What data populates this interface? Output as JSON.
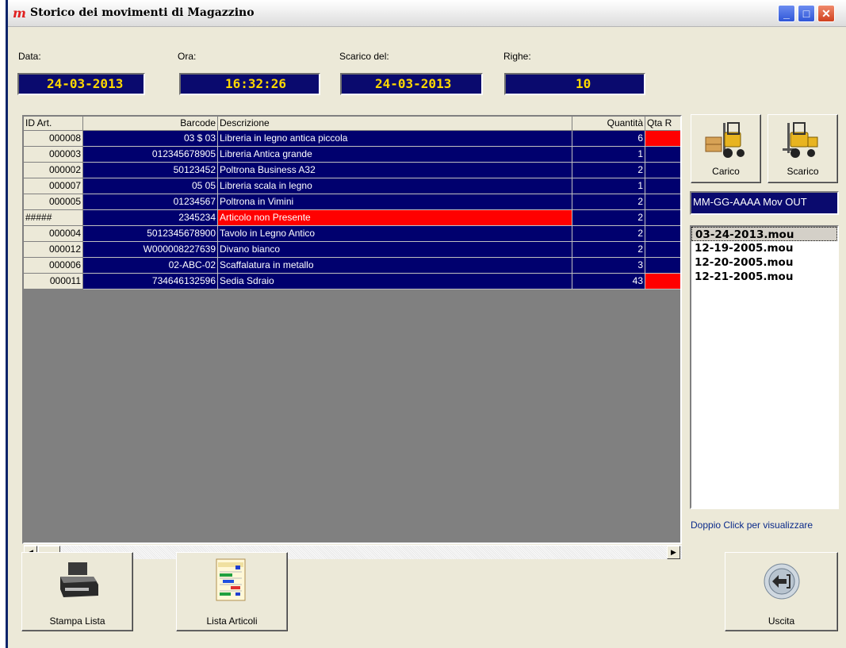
{
  "window": {
    "title": "Storico dei movimenti di Magazzino",
    "logo_glyph": "m",
    "controls": {
      "minimize": "_",
      "maximize": "□",
      "close": "✕"
    }
  },
  "info": {
    "data_label": "Data:",
    "data_value": "24-03-2013",
    "ora_label": "Ora:",
    "ora_value": "16:32:26",
    "scarico_label": "Scarico del:",
    "scarico_value": "24-03-2013",
    "righe_label": "Righe:",
    "righe_value": "10"
  },
  "table": {
    "columns": [
      "ID Art.",
      "Barcode",
      "Descrizione",
      "Quantità",
      "Qta R"
    ],
    "rows": [
      {
        "id": "000008",
        "barcode": "03 $ 03",
        "desc": "Libreria in legno antica piccola",
        "qty": "6",
        "flag": true,
        "bad": false
      },
      {
        "id": "000003",
        "barcode": "012345678905",
        "desc": "Libreria Antica grande",
        "qty": "1",
        "flag": false,
        "bad": false
      },
      {
        "id": "000002",
        "barcode": "50123452",
        "desc": "Poltrona Business A32",
        "qty": "2",
        "flag": false,
        "bad": false
      },
      {
        "id": "000007",
        "barcode": "05 05",
        "desc": "Libreria scala in legno",
        "qty": "1",
        "flag": false,
        "bad": false
      },
      {
        "id": "000005",
        "barcode": "01234567",
        "desc": "Poltrona in Vimini",
        "qty": "2",
        "flag": false,
        "bad": false
      },
      {
        "id": "#####",
        "barcode": "2345234",
        "desc": "Articolo non Presente",
        "qty": "2",
        "flag": false,
        "bad": true
      },
      {
        "id": "000004",
        "barcode": "5012345678900",
        "desc": "Tavolo in Legno Antico",
        "qty": "2",
        "flag": false,
        "bad": false
      },
      {
        "id": "000012",
        "barcode": "W000008227639",
        "desc": "Divano bianco",
        "qty": "2",
        "flag": false,
        "bad": false
      },
      {
        "id": "000006",
        "barcode": "02-ABC-02",
        "desc": "Scaffalatura in metallo",
        "qty": "3",
        "flag": false,
        "bad": false
      },
      {
        "id": "000011",
        "barcode": "734646132596",
        "desc": "Sedia Sdraio",
        "qty": "43",
        "flag": true,
        "bad": false
      }
    ]
  },
  "scrollbar": {
    "left_arrow": "◀",
    "right_arrow": "▶"
  },
  "side": {
    "carico_label": "Carico",
    "scarico_label": "Scarico",
    "date_format": "MM-GG-AAAA Mov OUT",
    "files": [
      "03-24-2013.mou",
      "12-19-2005.mou",
      "12-20-2005.mou",
      "12-21-2005.mou"
    ],
    "selected_file_index": 0,
    "hint": "Doppio Click per visualizzare"
  },
  "bottom": {
    "stampa_label": "Stampa Lista",
    "articoli_label": "Lista Articoli",
    "uscita_label": "Uscita"
  },
  "colors": {
    "field_bg": "#0a0a6e",
    "field_text": "#ffd800",
    "grid_row_bg": "#00006e",
    "alert": "#ff0000"
  },
  "icons": {
    "carico": "forklift-load-icon",
    "scarico": "forklift-unload-icon",
    "stampa": "printer-icon",
    "articoli": "list-document-icon",
    "uscita": "exit-icon"
  }
}
